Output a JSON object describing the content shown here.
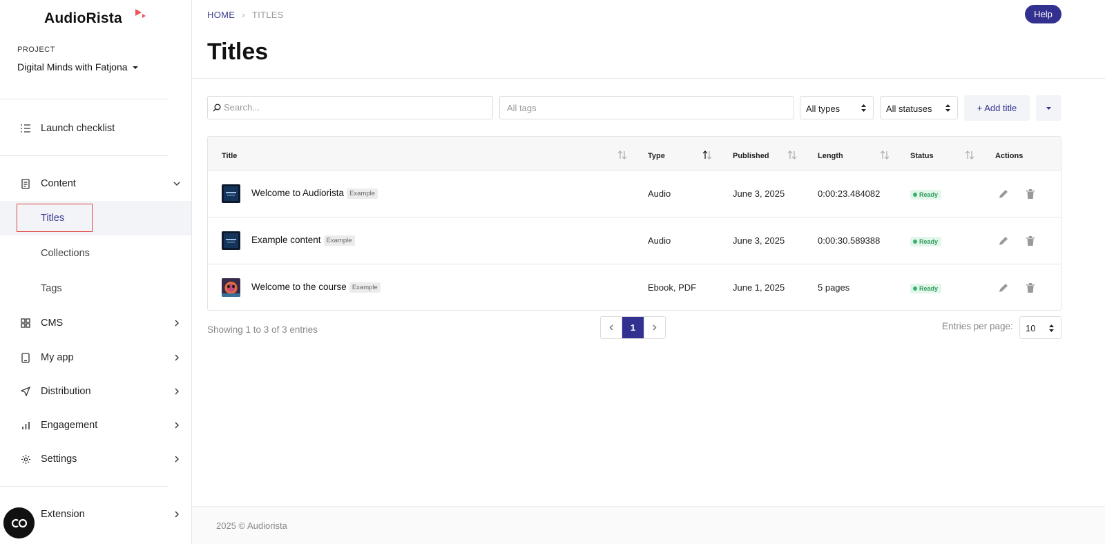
{
  "app": {
    "logo": "AudioRista"
  },
  "sidebar": {
    "project_label": "PROJECT",
    "project_name": "Digital Minds with Fatjona",
    "launch_checklist": "Launch checklist",
    "content": "Content",
    "content_sub": {
      "titles": "Titles",
      "collections": "Collections",
      "tags": "Tags"
    },
    "cms": "CMS",
    "my_app": "My app",
    "distribution": "Distribution",
    "engagement": "Engagement",
    "settings": "Settings",
    "extension": "Extension"
  },
  "breadcrumb": {
    "home": "HOME",
    "current": "TITLES"
  },
  "header": {
    "help": "Help",
    "title": "Titles"
  },
  "filters": {
    "search_placeholder": "Search...",
    "tags_placeholder": "All tags",
    "types": "All types",
    "statuses": "All statuses",
    "add_title": "+ Add title"
  },
  "table": {
    "columns": {
      "title": "Title",
      "type": "Type",
      "published": "Published",
      "length": "Length",
      "status": "Status",
      "actions": "Actions"
    },
    "rows": [
      {
        "title": "Welcome to Audiorista",
        "badge": "Example",
        "type": "Audio",
        "published": "June 3, 2025",
        "length": "0:00:23.484082",
        "status": "Ready"
      },
      {
        "title": "Example content",
        "badge": "Example",
        "type": "Audio",
        "published": "June 3, 2025",
        "length": "0:00:30.589388",
        "status": "Ready"
      },
      {
        "title": "Welcome to the course",
        "badge": "Example",
        "type": "Ebook, PDF",
        "published": "June 1, 2025",
        "length": "5 pages",
        "status": "Ready"
      }
    ]
  },
  "pagination": {
    "showing": "Showing 1 to 3 of 3 entries",
    "current_page": "1",
    "entries_label": "Entries per page:",
    "entries_value": "10"
  },
  "footer": {
    "text": "2025 © Audiorista"
  },
  "colors": {
    "accent": "#33318f",
    "highlight": "#e0433e",
    "ready_bg": "#e2f6ea",
    "ready_text": "#2e9b5c"
  }
}
